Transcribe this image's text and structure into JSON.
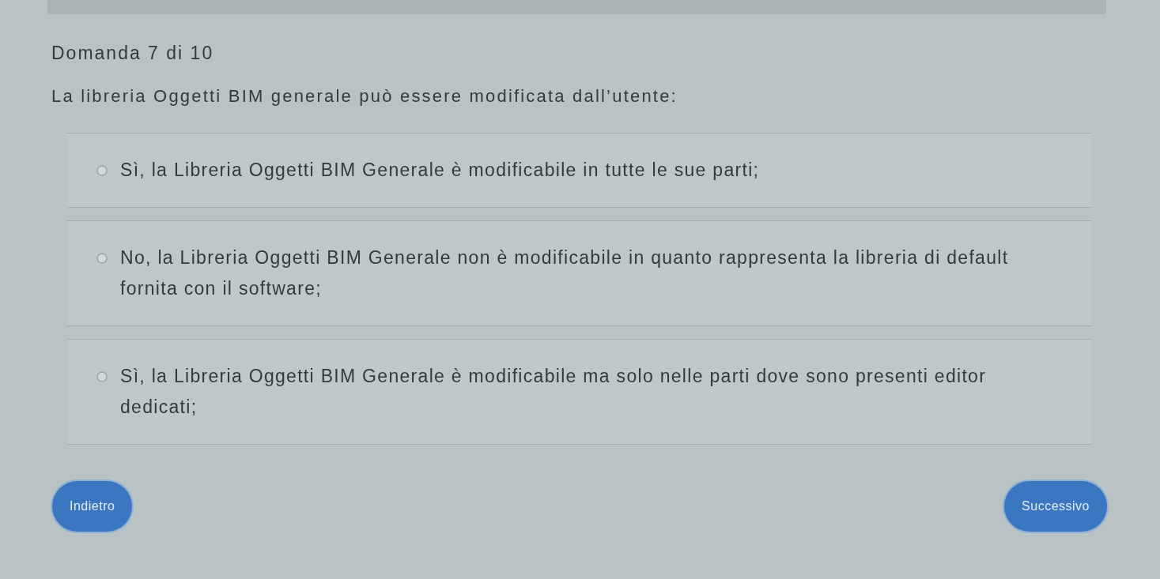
{
  "progress": "Domanda 7 di 10",
  "question": "La libreria Oggetti BIM generale può essere modificata dall’utente:",
  "answers": [
    {
      "text": "Sì, la Libreria Oggetti BIM Generale è modificabile in tutte le sue parti;",
      "selected": false
    },
    {
      "text": "No, la Libreria Oggetti BIM Generale non è modificabile in quanto rappresenta la libreria di default fornita con il software;",
      "selected": false
    },
    {
      "text": "Sì, la Libreria Oggetti BIM Generale è modificabile ma solo nelle parti dove sono presenti editor dedicati;",
      "selected": false
    }
  ],
  "buttons": [
    {
      "label": "Indietro"
    },
    {
      "label": "Successivo"
    }
  ]
}
